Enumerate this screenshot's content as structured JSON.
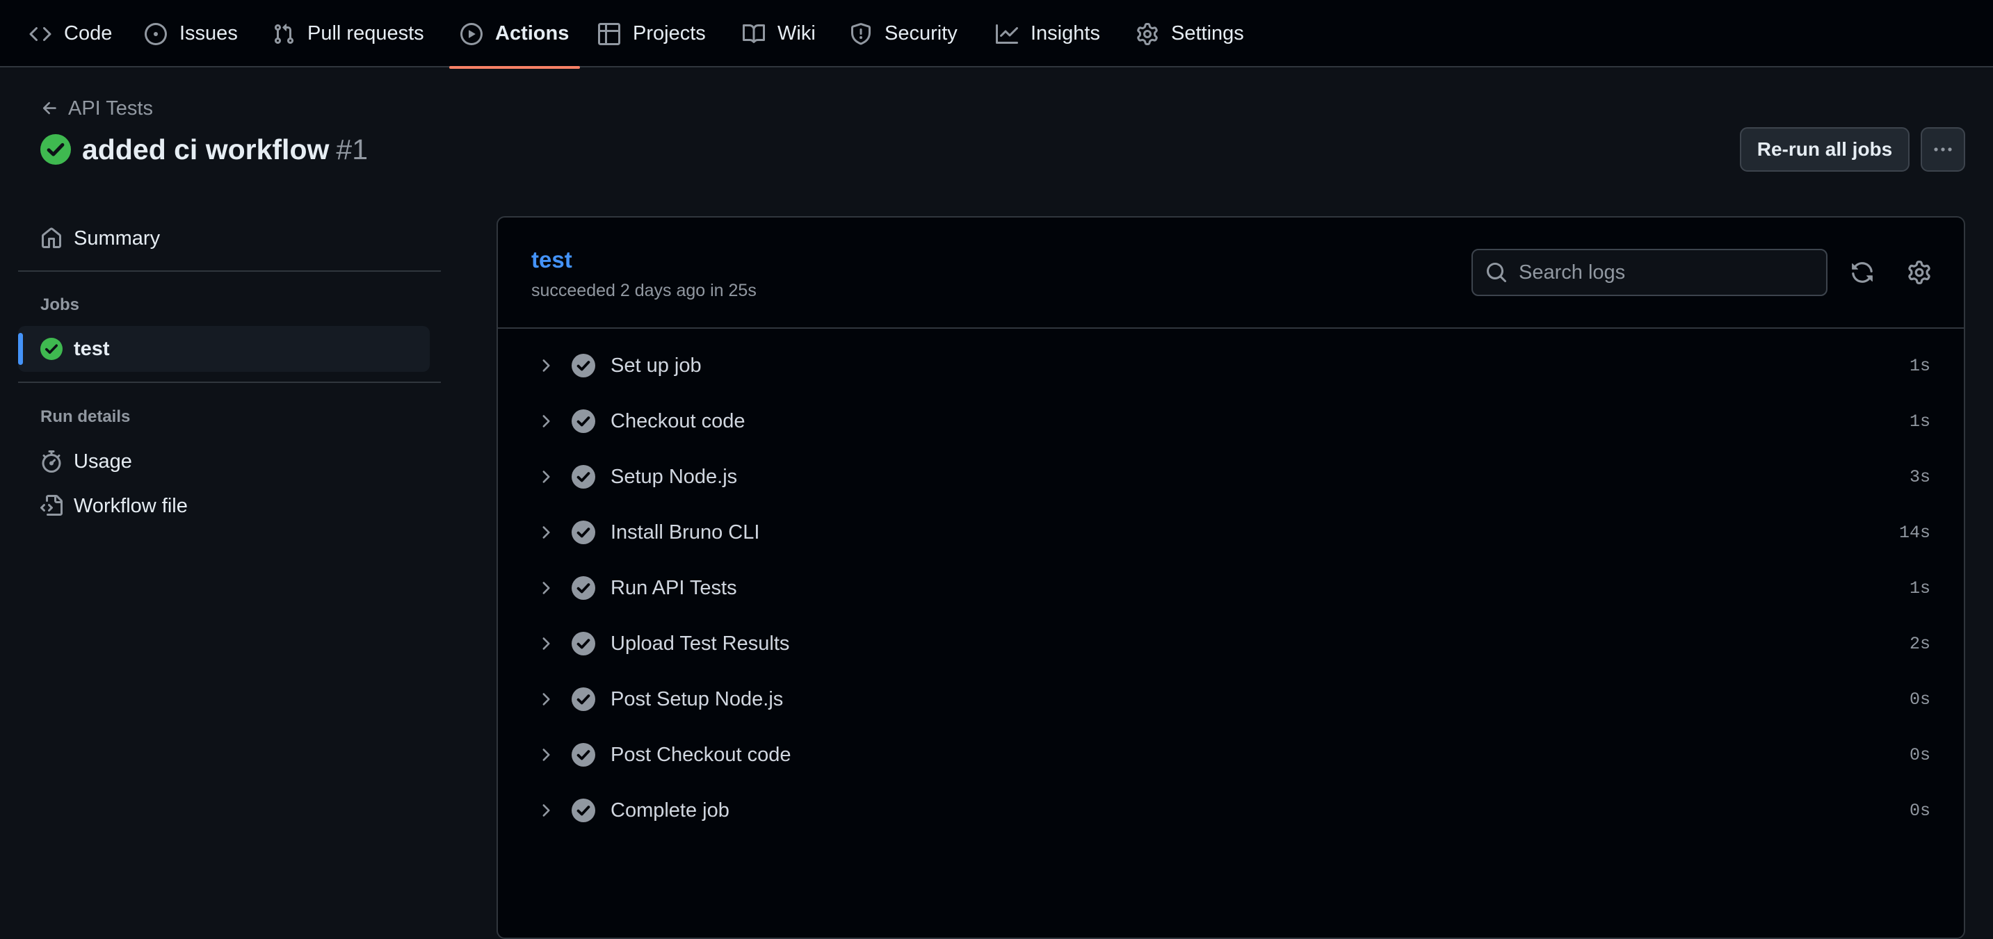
{
  "nav": {
    "tabs": [
      {
        "label": "Code",
        "icon": "code-icon"
      },
      {
        "label": "Issues",
        "icon": "issue-opened-icon"
      },
      {
        "label": "Pull requests",
        "icon": "git-pull-request-icon"
      },
      {
        "label": "Actions",
        "icon": "play-icon",
        "active": true
      },
      {
        "label": "Projects",
        "icon": "table-icon"
      },
      {
        "label": "Wiki",
        "icon": "book-icon"
      },
      {
        "label": "Security",
        "icon": "shield-icon"
      },
      {
        "label": "Insights",
        "icon": "graph-icon"
      },
      {
        "label": "Settings",
        "icon": "gear-icon"
      }
    ],
    "active_underline_color": "#f78166"
  },
  "header": {
    "back_label": "API Tests",
    "title": "added ci workflow",
    "run_number": "#1",
    "status": "success",
    "rerun_label": "Re-run all jobs",
    "more_icon": "kebab-horizontal-icon"
  },
  "sidebar": {
    "summary_label": "Summary",
    "jobs_heading": "Jobs",
    "jobs": [
      {
        "label": "test",
        "status": "success",
        "selected": true
      }
    ],
    "run_details_heading": "Run details",
    "usage_label": "Usage",
    "workflow_file_label": "Workflow file"
  },
  "job": {
    "name": "test",
    "meta": "succeeded 2 days ago in 25s",
    "search_placeholder": "Search logs",
    "steps": [
      {
        "name": "Set up job",
        "duration": "1s"
      },
      {
        "name": "Checkout code",
        "duration": "1s"
      },
      {
        "name": "Setup Node.js",
        "duration": "3s"
      },
      {
        "name": "Install Bruno CLI",
        "duration": "14s"
      },
      {
        "name": "Run API Tests",
        "duration": "1s"
      },
      {
        "name": "Upload Test Results",
        "duration": "2s"
      },
      {
        "name": "Post Setup Node.js",
        "duration": "0s"
      },
      {
        "name": "Post Checkout code",
        "duration": "0s"
      },
      {
        "name": "Complete job",
        "duration": "0s"
      }
    ]
  },
  "colors": {
    "success": "#3fb950",
    "link": "#4493f8",
    "step_check": "#9198a1"
  }
}
